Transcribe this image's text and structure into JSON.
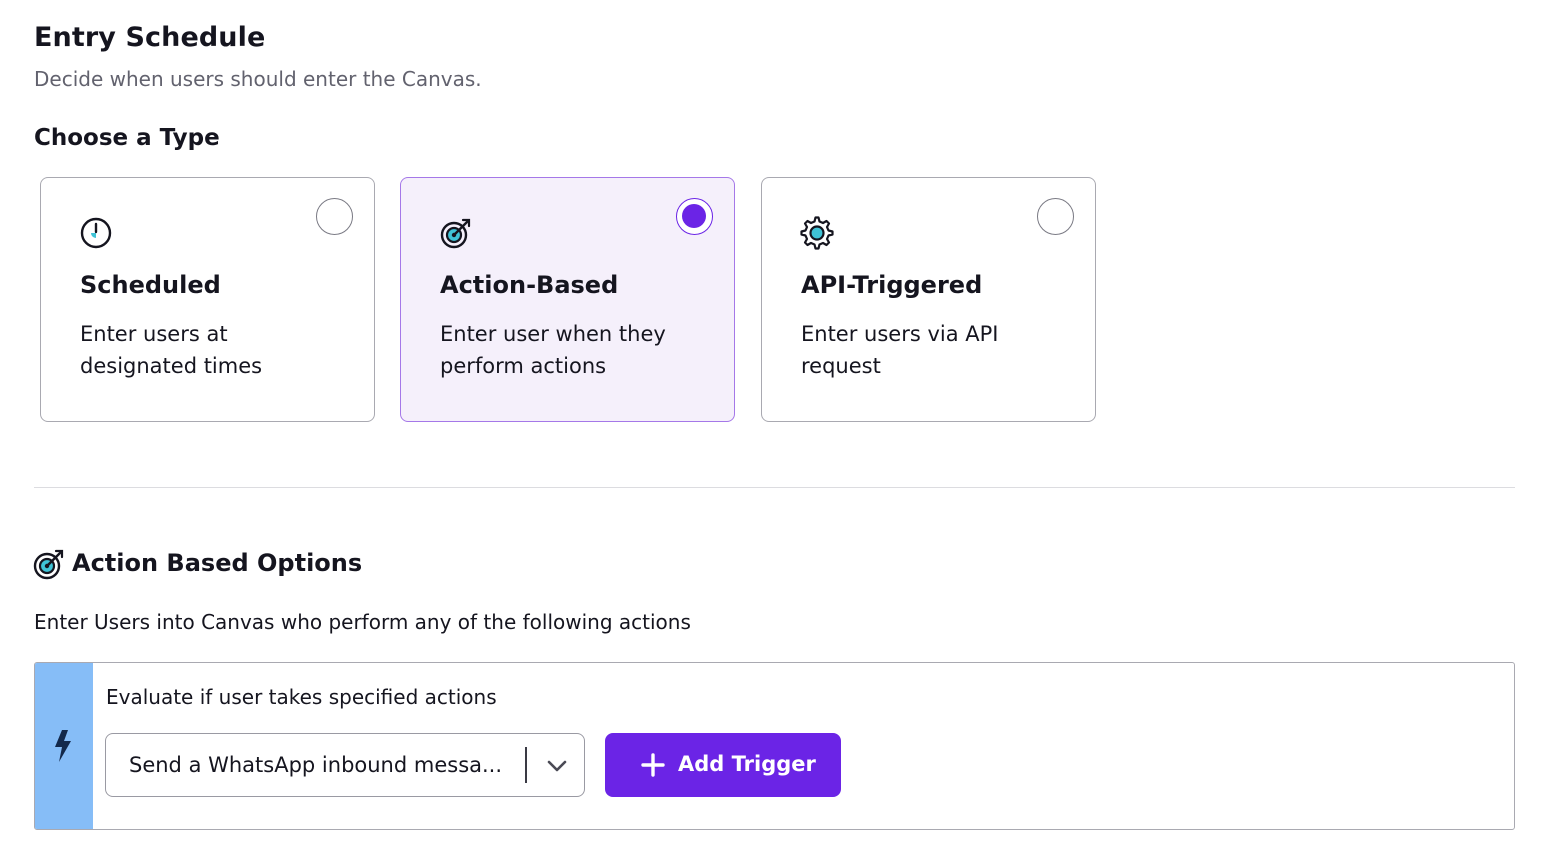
{
  "header": {
    "title": "Entry Schedule",
    "subtitle": "Decide when users should enter the Canvas."
  },
  "type_section": {
    "title": "Choose a Type",
    "options": [
      {
        "title": "Scheduled",
        "description": "Enter users at designated times",
        "icon": "clock-icon",
        "selected": false
      },
      {
        "title": "Action-Based",
        "description": "Enter user when they perform actions",
        "icon": "target-icon",
        "selected": true
      },
      {
        "title": "API-Triggered",
        "description": "Enter users via API request",
        "icon": "gear-icon",
        "selected": false
      }
    ]
  },
  "action_options": {
    "title": "Action Based Options",
    "description": "Enter Users into Canvas who perform any of the following actions",
    "evaluate_label": "Evaluate if user takes specified actions",
    "selected_action": "Send a WhatsApp inbound messa...",
    "add_trigger_label": "Add Trigger",
    "icons": {
      "header": "target-icon",
      "strip": "lightning-bolt-icon",
      "dropdown": "chevron-down-icon",
      "button": "plus-icon"
    }
  },
  "colors": {
    "accent": "#6b24e6",
    "selected_card_bg": "#f5f0fb",
    "selected_card_border": "#a578e8",
    "icon_teal": "#3fc3d6",
    "strip_blue": "#86bdf7",
    "bolt_navy": "#13294b"
  }
}
